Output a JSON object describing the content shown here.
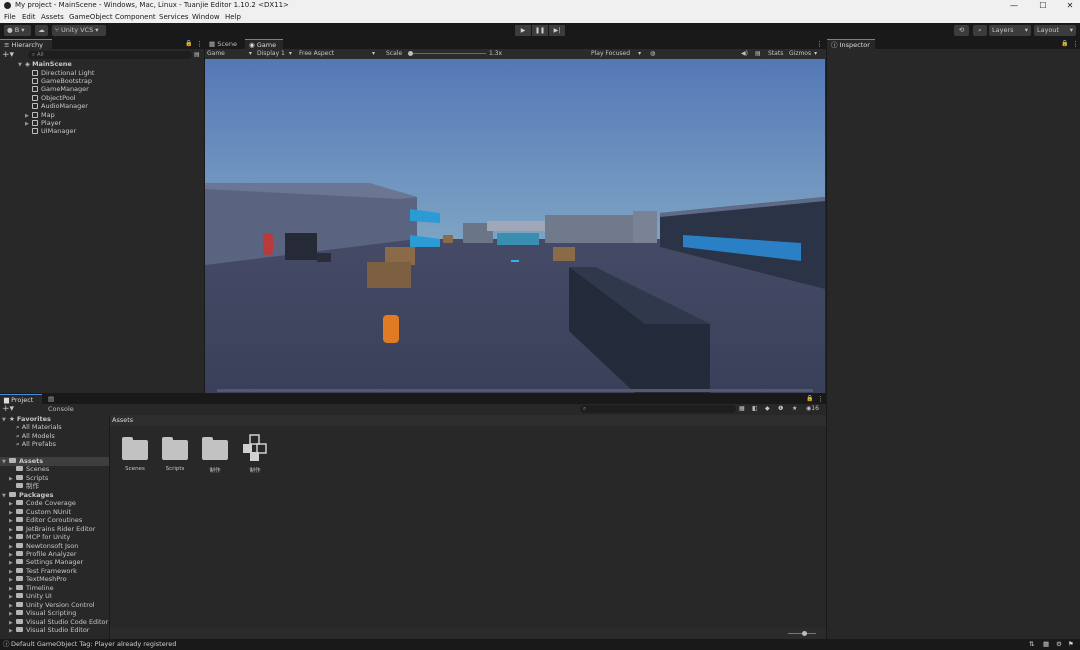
{
  "window": {
    "title": "My project - MainScene - Windows, Mac, Linux - Tuanjie Editor 1.10.2 <DX11>"
  },
  "menu": [
    "File",
    "Edit",
    "Assets",
    "GameObject",
    "Component",
    "Services",
    "Window",
    "Help"
  ],
  "toolbar": {
    "account": "B ▾",
    "vcs": "Unity VCS ▾",
    "layers": "Layers",
    "layout": "Layout"
  },
  "hierarchy": {
    "tab": "Hierarchy",
    "search_placeholder": "All",
    "scene": "MainScene",
    "items": [
      "Directional Light",
      "GameBootstrap",
      "GameManager",
      "ObjectPool",
      "AudioManager",
      "Map",
      "Player",
      "UIManager"
    ]
  },
  "view": {
    "tabs": [
      "Scene",
      "Game"
    ],
    "game_label": "Game",
    "display": "Display 1",
    "aspect": "Free Aspect",
    "scale_label": "Scale",
    "scale_value": "1.3x",
    "play_focused": "Play Focused",
    "stats": "Stats",
    "gizmos": "Gizmos"
  },
  "inspector": {
    "tab": "Inspector"
  },
  "project": {
    "tabs": [
      "Project",
      "Console"
    ],
    "favorites": {
      "label": "Favorites",
      "items": [
        "All Materials",
        "All Models",
        "All Prefabs"
      ]
    },
    "assets": {
      "label": "Assets",
      "items": [
        "Scenes",
        "Scripts",
        "制作"
      ]
    },
    "packages": {
      "label": "Packages",
      "items": [
        "Code Coverage",
        "Custom NUnit",
        "Editor Coroutines",
        "JetBrains Rider Editor",
        "MCP for Unity",
        "Newtonsoft Json",
        "Profile Analyzer",
        "Settings Manager",
        "Test Framework",
        "TextMeshPro",
        "Timeline",
        "Unity UI",
        "Unity Version Control",
        "Visual Scripting",
        "Visual Studio Code Editor",
        "Visual Studio Editor"
      ]
    },
    "breadcrumb": "Assets",
    "grid": [
      "Scenes",
      "Scripts",
      "制作",
      "制作"
    ],
    "count": "16"
  },
  "status": {
    "message": "Default GameObject Tag: Player already registered"
  },
  "colors": {
    "accent": "#4a8bd6",
    "panel": "#282828",
    "dark": "#191919"
  }
}
